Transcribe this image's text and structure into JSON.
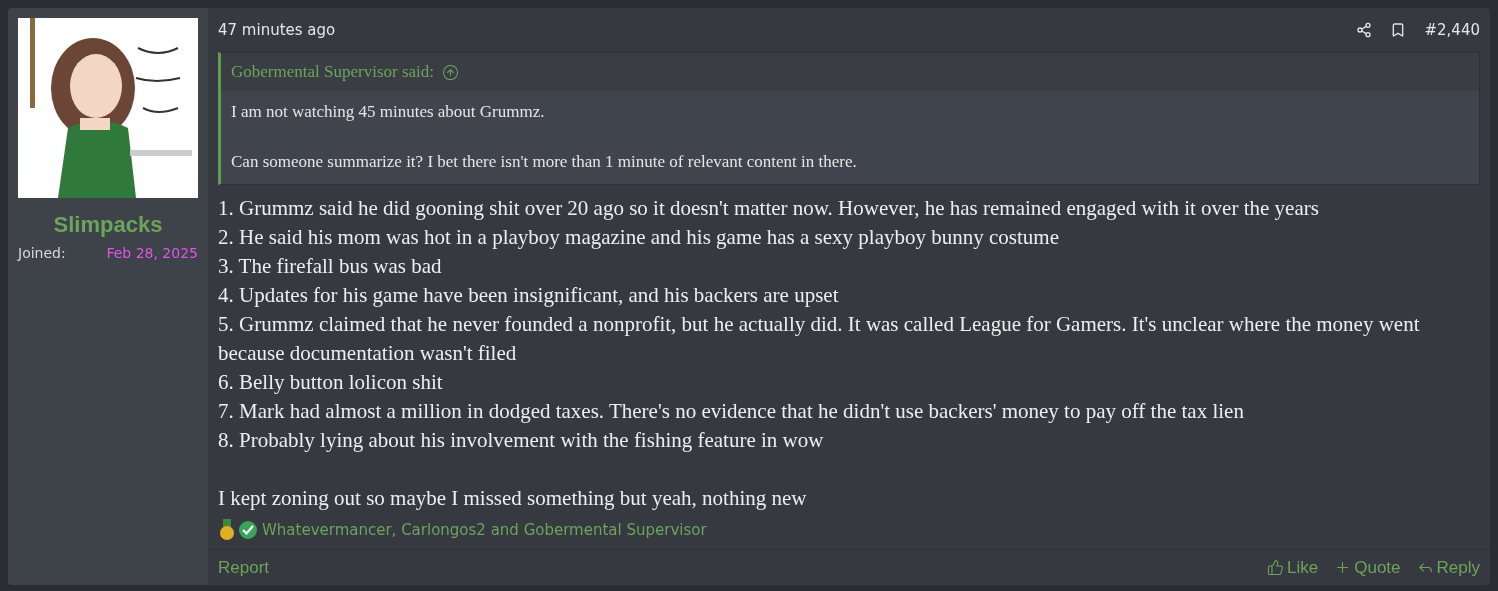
{
  "user": {
    "name": "Slimpacks",
    "joined_label": "Joined:",
    "joined_date": "Feb 28, 2025"
  },
  "post": {
    "time": "47 minutes ago",
    "number": "#2,440",
    "quote": {
      "attribution": "Gobermental Supervisor said:",
      "paragraphs": [
        "I am not watching 45 minutes about Grummz.",
        "Can someone summarize it? I bet there isn't more than 1 minute of relevant content in there."
      ]
    },
    "lines": [
      "1. Grummz said he did gooning shit over 20 ago so it doesn't matter now. However, he has remained engaged with it over the years",
      "2. He said his mom was hot in a playboy magazine and his game has a sexy playboy bunny costume",
      "3. The firefall bus was bad",
      "4. Updates for his game have been insignificant, and his backers are upset",
      "5. Grummz claimed that he never founded a nonprofit, but he actually did. It was called League for Gamers. It's unclear where the money went because documentation wasn't filed",
      "6. Belly button lolicon shit",
      "7. Mark had almost a million in dodged taxes. There's no evidence that he didn't use backers' money to pay off the tax lien",
      "8. Probably lying about his involvement with the fishing feature in wow"
    ],
    "closing": "I kept zoning out so maybe I missed something but yeah, nothing new",
    "reactions": "Whatevermancer, Carlongos2 and Gobermental Supervisor",
    "report": "Report",
    "actions": [
      {
        "kind": "like",
        "label": "Like"
      },
      {
        "kind": "quote",
        "label": "Quote"
      },
      {
        "kind": "reply",
        "label": "Reply"
      }
    ]
  }
}
